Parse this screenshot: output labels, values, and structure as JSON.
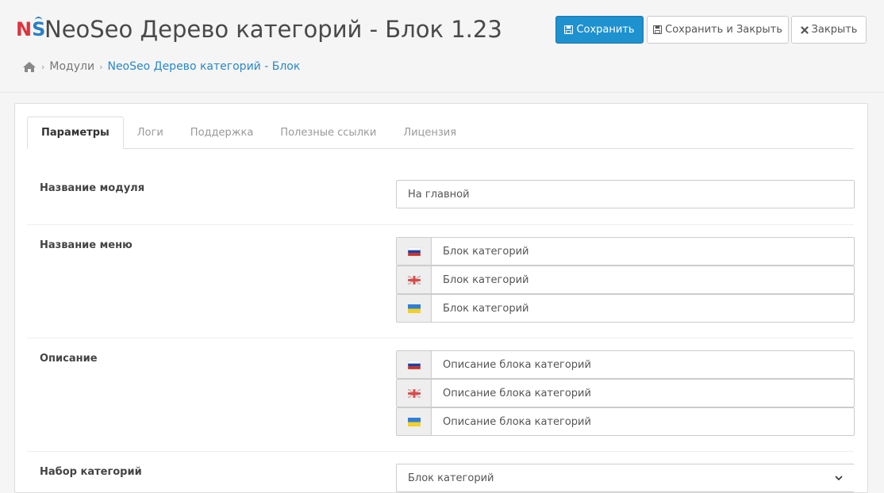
{
  "header": {
    "logo_n": "N",
    "logo_s": "S",
    "title": "NeoSeo Дерево категорий - Блок 1.23"
  },
  "toolbar": {
    "save_label": "Сохранить",
    "save_close_label": "Сохранить и Закрыть",
    "close_label": "Закрыть"
  },
  "breadcrumb": {
    "home_icon": "home-icon",
    "items": [
      "Модули",
      "NeoSeo Дерево категорий - Блок"
    ]
  },
  "tabs": [
    "Параметры",
    "Логи",
    "Поддержка",
    "Полезные ссылки",
    "Лицензия"
  ],
  "form": {
    "module_name": {
      "label": "Название модуля",
      "value": "На главной"
    },
    "menu_name": {
      "label": "Название меню",
      "values": [
        {
          "flag": "ru",
          "value": "Блок категорий"
        },
        {
          "flag": "en",
          "value": "Блок категорий"
        },
        {
          "flag": "ua",
          "value": "Блок категорий"
        }
      ]
    },
    "description": {
      "label": "Описание",
      "values": [
        {
          "flag": "ru",
          "value": "Описание блока категорий"
        },
        {
          "flag": "en",
          "value": "Описание блока категорий"
        },
        {
          "flag": "ua",
          "value": "Описание блока категорий"
        }
      ]
    },
    "category_set": {
      "label": "Набор категорий",
      "value": "Блок категорий"
    }
  },
  "colors": {
    "primary": "#1e91cf",
    "link": "#2a87c8",
    "logo_red": "#e1323c",
    "logo_blue": "#2a7fc5"
  }
}
